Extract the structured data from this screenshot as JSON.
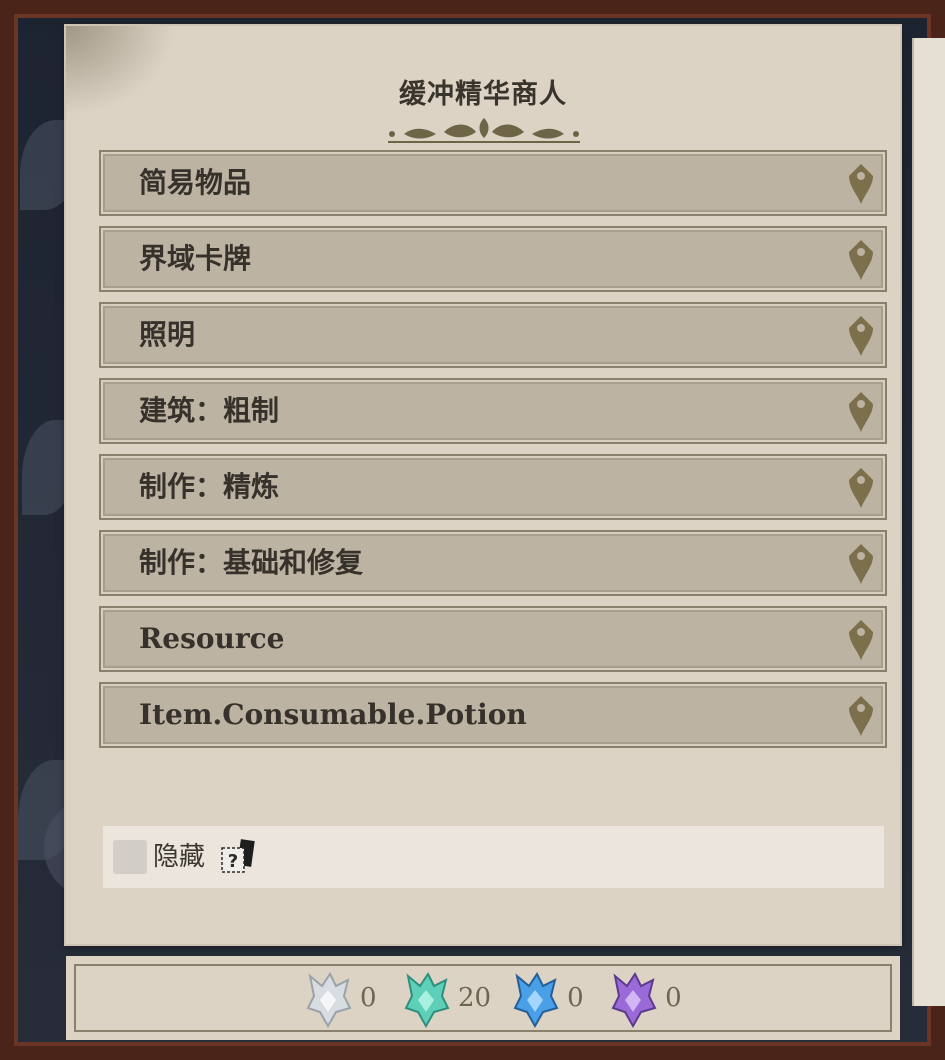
{
  "title": "缓冲精华商人",
  "categories": [
    {
      "label": "简易物品"
    },
    {
      "label": "界域卡牌"
    },
    {
      "label": "照明"
    },
    {
      "label": "建筑：粗制"
    },
    {
      "label": "制作：精炼"
    },
    {
      "label": "制作：基础和修复"
    },
    {
      "label": "Resource"
    },
    {
      "label": "Item.Consumable.Potion"
    }
  ],
  "hide_toggle": {
    "label": "隐藏",
    "checked": false
  },
  "currencies": [
    {
      "icon": "white-essence-icon",
      "value": "0",
      "color": "#d8dde2"
    },
    {
      "icon": "teal-essence-icon",
      "value": "20",
      "color": "#5fd0b8"
    },
    {
      "icon": "blue-essence-icon",
      "value": "0",
      "color": "#4aa0e6"
    },
    {
      "icon": "purple-essence-icon",
      "value": "0",
      "color": "#9a6ad8"
    }
  ],
  "colors": {
    "panel": "#dcd3c5",
    "item": "#bdb3a3",
    "accent": "#7c6f4c"
  }
}
